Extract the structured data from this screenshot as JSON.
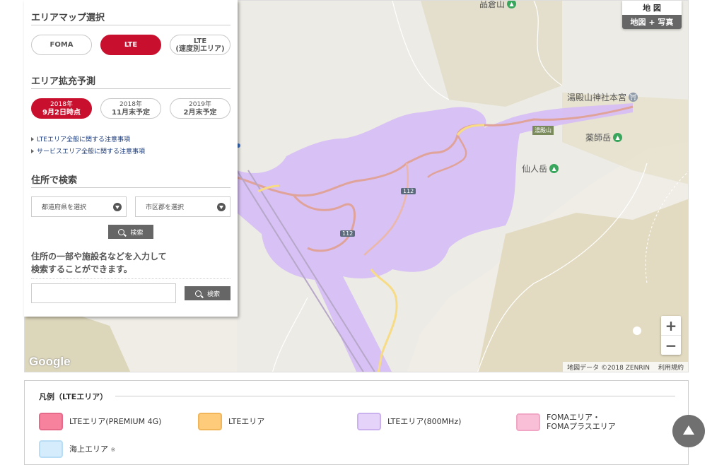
{
  "panel": {
    "area_map": {
      "title": "エリアマップ選択",
      "buttons": [
        {
          "label": "FOMA",
          "sub": ""
        },
        {
          "label": "LTE",
          "sub": ""
        },
        {
          "label": "LTE",
          "sub": "(速度別エリア)"
        }
      ],
      "selected": "LTE"
    },
    "forecast": {
      "title": "エリア拡充予測",
      "buttons": [
        {
          "year": "2018年",
          "label": "9月2日時点"
        },
        {
          "year": "2018年",
          "label": "11月末予定"
        },
        {
          "year": "2019年",
          "label": "2月末予定"
        }
      ]
    },
    "links": [
      "LTEエリア全般に関する注意事項",
      "サービスエリア全般に関する注意事項"
    ],
    "address_search": {
      "title": "住所で検索",
      "prefecture_select": "都道府県を選択",
      "city_select": "市区郡を選択",
      "search_label": "検索"
    },
    "keyword_search": {
      "hint_line1": "住所の一部や施設名などを入力して",
      "hint_line2": "検索することができます。",
      "value": "",
      "search_label": "検索"
    }
  },
  "map": {
    "map_type": {
      "map": "地 図",
      "hybrid": "地図 + 写真"
    },
    "pois": [
      {
        "name": "品倉山",
        "icon": "mountain-icon"
      },
      {
        "name": "湯殿山神社本宮",
        "icon": "shrine-icon"
      },
      {
        "name": "薬師岳",
        "icon": "mountain-icon"
      },
      {
        "name": "仙人岳",
        "icon": "mountain-icon"
      }
    ],
    "place_label": "湯殿山",
    "route_labels": [
      "112",
      "112"
    ],
    "zoom_in": "+",
    "zoom_out": "−",
    "google": "Google",
    "attribution": "地図データ ©2018 ZENRIN",
    "terms": "利用規約"
  },
  "legend": {
    "title": "凡例（LTEエリア）",
    "items": [
      {
        "label": "LTEエリア(PREMIUM 4G)",
        "label2": "",
        "color": "#f7829e"
      },
      {
        "label": "LTEエリア",
        "label2": "",
        "color": "#fecb7a"
      },
      {
        "label": "LTEエリア(800MHz)",
        "label2": "",
        "color": "#dcc6f5"
      },
      {
        "label": "FOMAエリア・",
        "label2": "FOMAプラスエリア",
        "color": "#f8bfd6"
      },
      {
        "label": "海上エリア",
        "label2": "※",
        "color": "#d4ecfb"
      }
    ]
  },
  "colors": {
    "accent": "#c8102e",
    "coverage_800": "#d6bdf5"
  }
}
